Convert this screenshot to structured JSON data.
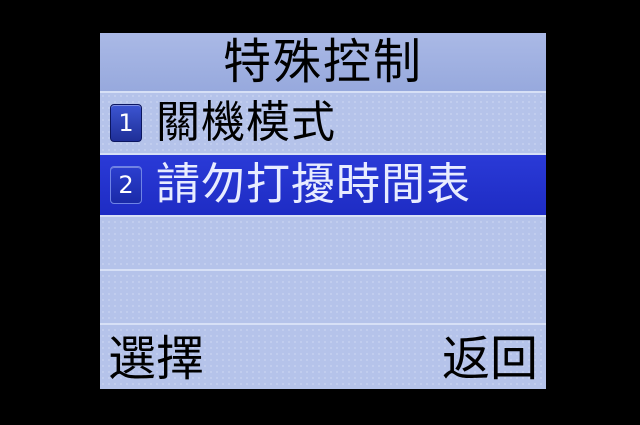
{
  "header": {
    "title": "特殊控制"
  },
  "menu": {
    "items": [
      {
        "number": "1",
        "label": "關機模式",
        "selected": false
      },
      {
        "number": "2",
        "label": "請勿打擾時間表",
        "selected": true
      }
    ]
  },
  "softkeys": {
    "left": "選擇",
    "right": "返回"
  },
  "colors": {
    "screen_background": "#b5c3ea",
    "selection_highlight": "#2a3ad7",
    "badge_blue": "#2c3fcf",
    "text": "#000000",
    "selected_text": "#e8ecff"
  }
}
